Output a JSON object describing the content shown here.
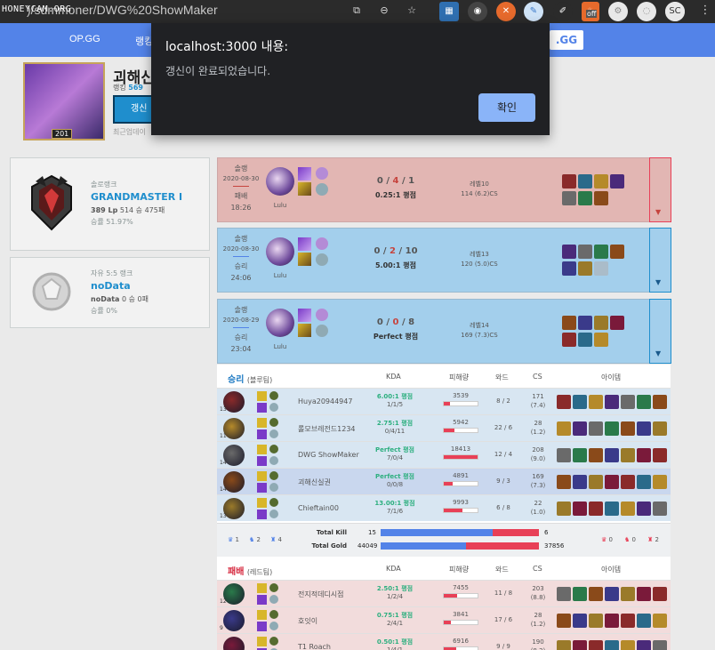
{
  "browser": {
    "url": ")/summoner/DWG%20ShowMaker",
    "watermark": "HONEYCAM.ORG",
    "ext_badge": "off",
    "profile_initials": "SC"
  },
  "sitenav": {
    "logo": "OP.GG",
    "link2": "랭킹",
    "search_label": ".GG"
  },
  "profile": {
    "name": "괴해신",
    "ladder_prefix": "랭킹",
    "ladder_rank": "569",
    "renew_button": "갱신",
    "level": "201",
    "last_updated": "최근업데이"
  },
  "dialog": {
    "title": "localhost:3000 내용:",
    "message": "갱신이 완료되었습니다.",
    "ok_label": "확인"
  },
  "ranks": [
    {
      "type": "솔로랭크",
      "tier": "GRANDMASTER I",
      "lp": "389 Lp",
      "record": "514 승 475패",
      "winrate": "승률 51.97%"
    },
    {
      "type": "자유 5:5 랭크",
      "tier": "noData",
      "lp": "noData",
      "record": "0 승 0패",
      "winrate": "승률 0%"
    }
  ],
  "games": [
    {
      "result_class": "loss",
      "type": "솔랭",
      "date": "2020-08-30",
      "result": "패배",
      "length": "18:26",
      "champion": "Lulu",
      "k": "0",
      "d": "4",
      "a": "1",
      "ratio": "0.25:1 평점",
      "level": "레벨10",
      "cs": "114 (6.2)CS"
    },
    {
      "result_class": "win",
      "type": "솔랭",
      "date": "2020-08-30",
      "result": "승리",
      "length": "24:06",
      "champion": "Lulu",
      "k": "0",
      "d": "2",
      "a": "10",
      "ratio": "5.00:1 평점",
      "level": "레벨13",
      "cs": "120 (5.0)CS"
    },
    {
      "result_class": "win",
      "type": "솔랭",
      "date": "2020-08-29",
      "result": "승리",
      "length": "23:04",
      "champion": "Lulu",
      "k": "0",
      "d": "0",
      "a": "8",
      "ratio": "Perfect 평점",
      "level": "레벨14",
      "cs": "169 (7.3)CS"
    }
  ],
  "detail": {
    "headers": {
      "kda": "KDA",
      "dmg": "피해량",
      "ward": "와드",
      "cs": "CS",
      "items": "아이템"
    },
    "blue_team": {
      "result": "승리",
      "label": "(블루팀)"
    },
    "red_team": {
      "result": "패배",
      "label": "(레드팀)"
    },
    "blue_players": [
      {
        "name": "Huya20944947",
        "lvl": "13",
        "kda": "6.00:1 평점",
        "kd": "1/1/5",
        "dmg": "3539",
        "dmg_pct": 0.19,
        "ward": "8 / 2",
        "cs": "171",
        "cspm": "(7.4)"
      },
      {
        "name": "롤모브레전드1234",
        "lvl": "11",
        "kda": "2.75:1 평점",
        "kd": "0/4/11",
        "dmg": "5942",
        "dmg_pct": 0.32,
        "ward": "22 / 6",
        "cs": "28",
        "cspm": "(1.2)"
      },
      {
        "name": "DWG ShowMaker",
        "lvl": "14",
        "kda": "Perfect 평점",
        "kd": "7/0/4",
        "dmg": "18413",
        "dmg_pct": 1.0,
        "ward": "12 / 4",
        "cs": "208",
        "cspm": "(9.0)"
      },
      {
        "name": "괴해신실권",
        "lvl": "14",
        "kda": "Perfect 평점",
        "kd": "0/0/8",
        "dmg": "4891",
        "dmg_pct": 0.27,
        "ward": "9 / 3",
        "cs": "169",
        "cspm": "(7.3)"
      },
      {
        "name": "Chieftain00",
        "lvl": "13",
        "kda": "13.00:1 평점",
        "kd": "7/1/6",
        "dmg": "9993",
        "dmg_pct": 0.54,
        "ward": "6 / 8",
        "cs": "22",
        "cspm": "(1.0)"
      }
    ],
    "summary": {
      "blue_baron": "1",
      "blue_dragon": "2",
      "blue_tower": "4",
      "red_baron": "0",
      "red_dragon": "0",
      "red_tower": "2",
      "kill_label": "Total Kill",
      "blue_kill": "15",
      "red_kill": "6",
      "kill_blue_frac": 0.71,
      "gold_label": "Total Gold",
      "blue_gold": "44049",
      "red_gold": "37856",
      "gold_blue_frac": 0.54
    },
    "red_players": [
      {
        "name": "전지적데디시점",
        "lvl": "12",
        "kda": "2.50:1 평점",
        "kd": "1/2/4",
        "dmg": "7455",
        "dmg_pct": 0.4,
        "ward": "11 / 8",
        "cs": "203",
        "cspm": "(8.8)"
      },
      {
        "name": "호잇이",
        "lvl": "9",
        "kda": "0.75:1 평점",
        "kd": "2/4/1",
        "dmg": "3841",
        "dmg_pct": 0.21,
        "ward": "17 / 6",
        "cs": "28",
        "cspm": "(1.2)"
      },
      {
        "name": "T1 Roach",
        "lvl": "",
        "kda": "0.50:1 평점",
        "kd": "1/4/1",
        "dmg": "6916",
        "dmg_pct": 0.38,
        "ward": "9 / 9",
        "cs": "190",
        "cspm": "(8.2)"
      }
    ]
  },
  "colors": {
    "blue": "#5383e8",
    "red": "#e84057",
    "loss_bg": "#e2b6b3",
    "win_bg": "#a3cfec"
  }
}
